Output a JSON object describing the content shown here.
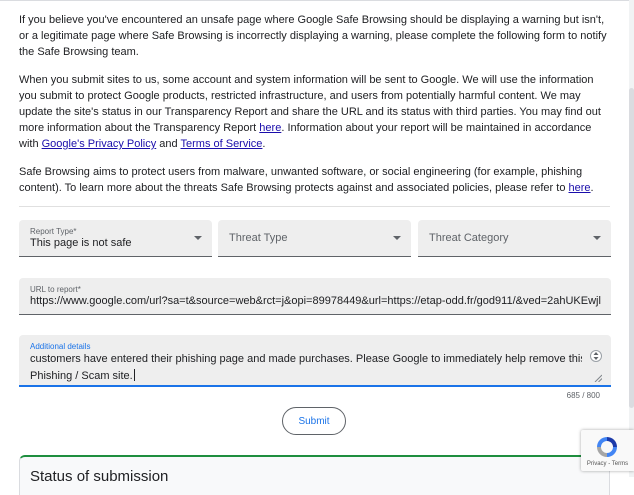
{
  "intro": {
    "p1": "If you believe you've encountered an unsafe page where Google Safe Browsing should be displaying a warning but isn't, or a legitimate page where Safe Browsing is incorrectly displaying a warning, please complete the following form to notify the Safe Browsing team.",
    "p2_a": "When you submit sites to us, some account and system information will be sent to Google. We will use the information you submit to protect Google products, restricted infrastructure, and users from potentially harmful content. We may update the site's status in our Transparency Report and share the URL and its status with third parties. You may find out more information about the Transparency Report ",
    "p2_link1": "here",
    "p2_b": ". Information about your report will be maintained in accordance with ",
    "p2_link2": "Google's Privacy Policy",
    "p2_c": " and ",
    "p2_link3": "Terms of Service",
    "p2_d": ".",
    "p3_a": "Safe Browsing aims to protect users from malware, unwanted software, or social engineering (for example, phishing content). To learn more about the threats Safe Browsing protects against and associated policies, please refer to ",
    "p3_link": "here",
    "p3_b": "."
  },
  "form": {
    "report_type": {
      "label": "Report Type*",
      "value": "This page is not safe"
    },
    "threat_type": {
      "placeholder": "Threat Type"
    },
    "threat_category": {
      "placeholder": "Threat Category"
    },
    "url": {
      "label": "URL to report*",
      "value": "https://www.google.com/url?sa=t&source=web&rct=j&opi=89978449&url=https://etap-odd.fr/god911/&ved=2ahUKEwjlic"
    },
    "details": {
      "label": "Additional details",
      "line1": "customers have entered their phishing page and made purchases. Please Google to immediately help remove this",
      "line2": "Phishing / Scam site."
    },
    "counter": "685 / 800",
    "submit_label": "Submit"
  },
  "status": {
    "title": "Status of submission"
  },
  "recaptcha": {
    "legal": "Privacy - Terms",
    "icon": "recaptcha-logo-icon"
  },
  "colors": {
    "accent": "#1a73e8",
    "link": "#1a0dab",
    "success": "#1e8e3e"
  }
}
